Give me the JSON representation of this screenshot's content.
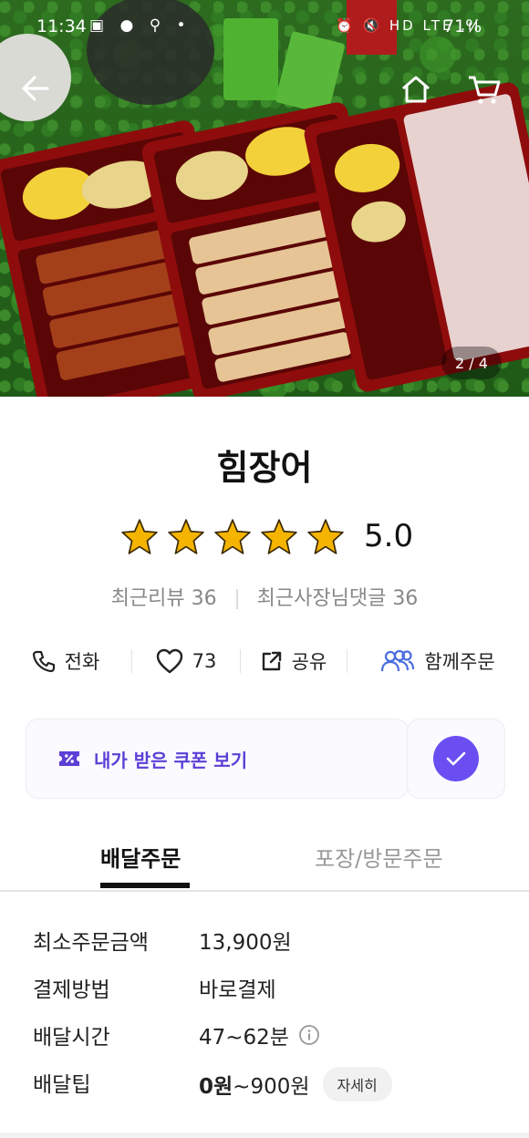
{
  "status_bar": {
    "time": "11:34",
    "left_icons": "▣ ● ⚲ •",
    "right_icons": "⏰ 🔇 HD LTE .ıl",
    "battery": "71%"
  },
  "hero": {
    "page_indicator": "2 / 4"
  },
  "store": {
    "name": "힘장어",
    "rating": "5.0",
    "stars_filled": 5,
    "recent_reviews": "최근리뷰 36",
    "owner_comments": "최근사장님댓글 36"
  },
  "actions": {
    "call_label": "전화",
    "like_count": "73",
    "share_label": "공유",
    "group_order_label": "함께주문"
  },
  "coupon": {
    "label": "내가 받은 쿠폰 보기"
  },
  "tabs": {
    "delivery": "배달주문",
    "pickup": "포장/방문주문"
  },
  "details": {
    "min_order_label": "최소주문금액",
    "min_order_value": "13,900원",
    "payment_label": "결제방법",
    "payment_value": "바로결제",
    "delivery_time_label": "배달시간",
    "delivery_time_value": "47~62분",
    "tip_label": "배달팁",
    "tip_value_bold": "0원",
    "tip_value_rest": "~900원",
    "tip_detail_button": "자세히"
  },
  "colors": {
    "accent": "#6a4ef2",
    "coupon_text": "#5b3fd6",
    "star": "#f5b400",
    "group_order_icon": "#4a6ce0"
  }
}
